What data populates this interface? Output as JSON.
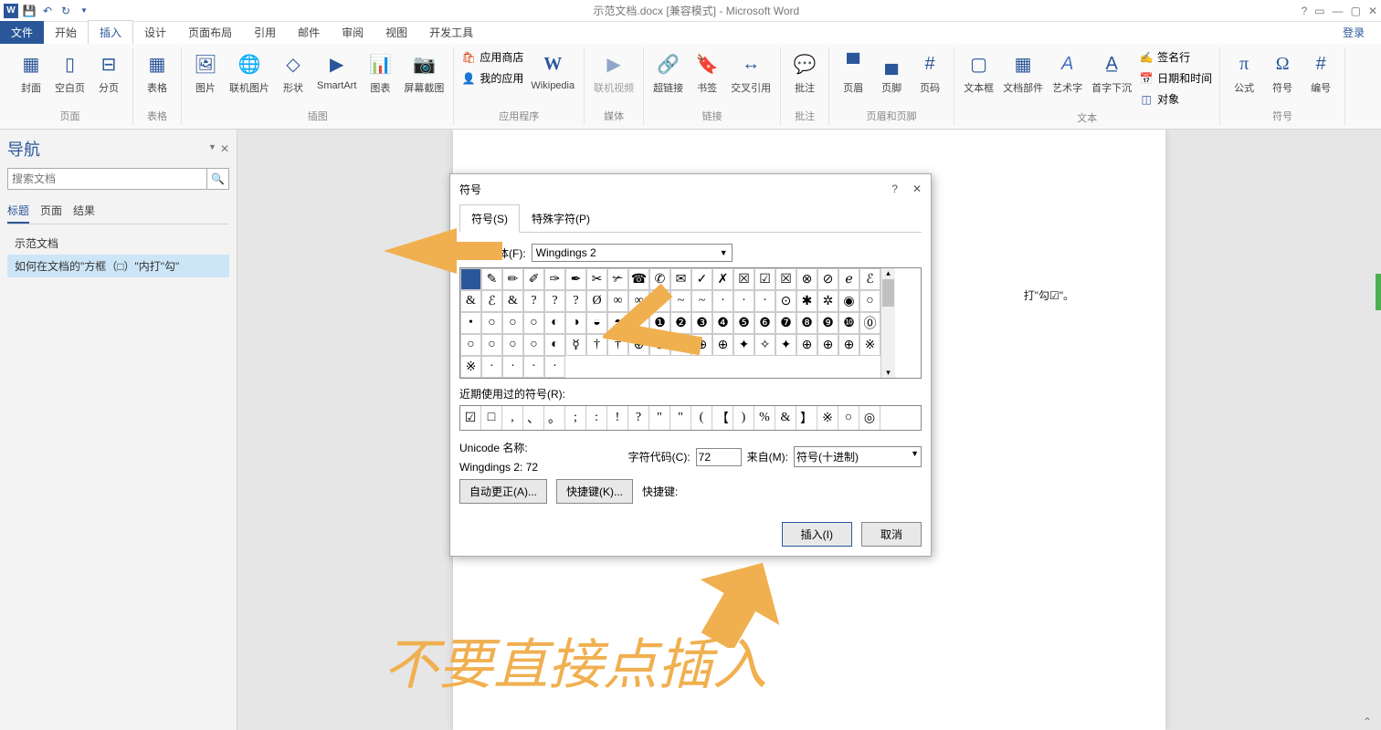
{
  "title": "示范文档.docx [兼容模式] - Microsoft Word",
  "login": "登录",
  "tabs": {
    "file": "文件",
    "home": "开始",
    "insert": "插入",
    "design": "设计",
    "layout": "页面布局",
    "ref": "引用",
    "mail": "邮件",
    "review": "审阅",
    "view": "视图",
    "dev": "开发工具"
  },
  "ribbon": {
    "pages": {
      "label": "页面",
      "cover": "封面",
      "blank": "空白页",
      "break": "分页"
    },
    "tables": {
      "label": "表格",
      "table": "表格"
    },
    "illus": {
      "label": "插图",
      "pic": "图片",
      "online": "联机图片",
      "shapes": "形状",
      "smart": "SmartArt",
      "chart": "图表",
      "screen": "屏幕截图"
    },
    "apps": {
      "label": "应用程序",
      "store": "应用商店",
      "my": "我的应用",
      "wiki": "Wikipedia"
    },
    "media": {
      "label": "媒体",
      "video": "联机视频"
    },
    "links": {
      "label": "链接",
      "hyper": "超链接",
      "bookmark": "书签",
      "crossref": "交叉引用"
    },
    "comments": {
      "label": "批注",
      "comment": "批注"
    },
    "hf": {
      "label": "页眉和页脚",
      "header": "页眉",
      "footer": "页脚",
      "pagenum": "页码"
    },
    "text": {
      "label": "文本",
      "textbox": "文本框",
      "parts": "文档部件",
      "wordart": "艺术字",
      "dropcap": "首字下沉",
      "sig": "签名行",
      "dt": "日期和时间",
      "obj": "对象"
    },
    "symbols": {
      "label": "符号",
      "eq": "公式",
      "sym": "符号",
      "num": "编号"
    }
  },
  "nav": {
    "title": "导航",
    "search_ph": "搜索文档",
    "tabs": {
      "headings": "标题",
      "pages": "页面",
      "results": "结果"
    },
    "items": [
      "示范文档",
      "如何在文档的\"方框（□）\"内打\"勾\""
    ]
  },
  "doc": {
    "title": "示范文档",
    "line": "打\"勾☑\"。"
  },
  "dialog": {
    "title": "符号",
    "help": "?",
    "close": "✕",
    "tab1": "符号(S)",
    "tab2": "特殊字符(P)",
    "font_label": "字体(F):",
    "font_value": "Wingdings 2",
    "recent_label": "近期使用过的符号(R):",
    "unicode_label": "Unicode 名称:",
    "font_info": "Wingdings 2: 72",
    "code_label": "字符代码(C):",
    "code_value": "72",
    "from_label": "来自(M):",
    "from_value": "符号(十进制)",
    "autocorrect": "自动更正(A)...",
    "shortcut": "快捷键(K)...",
    "shortcut_label": "快捷键:",
    "insert": "插入(I)",
    "cancel": "取消",
    "grid": [
      "",
      "✎",
      "✏",
      "✐",
      "✑",
      "✒",
      "✂",
      "✃",
      "☎",
      "✆",
      "✉",
      "✓",
      "✗",
      "☒",
      "☑",
      "☒",
      "⊗",
      "⊘",
      "ℯ",
      "ℰ",
      "&",
      "ℰ",
      "&",
      "?",
      "?",
      "?",
      "Ø",
      "∞",
      "∞",
      "∞",
      "~",
      "~",
      "·",
      "·",
      "·",
      "⊙",
      "✱",
      "✲",
      "◉",
      "○",
      "•",
      "○",
      "○",
      "○",
      "◐",
      "◑",
      "◒",
      "◓",
      "○",
      "❶",
      "❷",
      "❸",
      "❹",
      "❺",
      "❻",
      "❼",
      "❽",
      "❾",
      "❿",
      "⓪",
      "○",
      "○",
      "○",
      "○",
      "◐",
      "☿",
      "†",
      "†",
      "⊕",
      "⊕",
      "⊕",
      "⊕",
      "⊕",
      "✦",
      "✧",
      "✦",
      "⊕",
      "⊕",
      "⊕",
      "※",
      "※",
      "·",
      "·",
      "·",
      "·"
    ],
    "recent": [
      "☑",
      "□",
      ",",
      "、",
      "。",
      ";",
      ":",
      "!",
      "?",
      "\"",
      "\"",
      "(",
      "【",
      ")",
      "%",
      "&",
      "】",
      "※",
      "○",
      "◎"
    ]
  },
  "annotation": "不要直接点插入"
}
